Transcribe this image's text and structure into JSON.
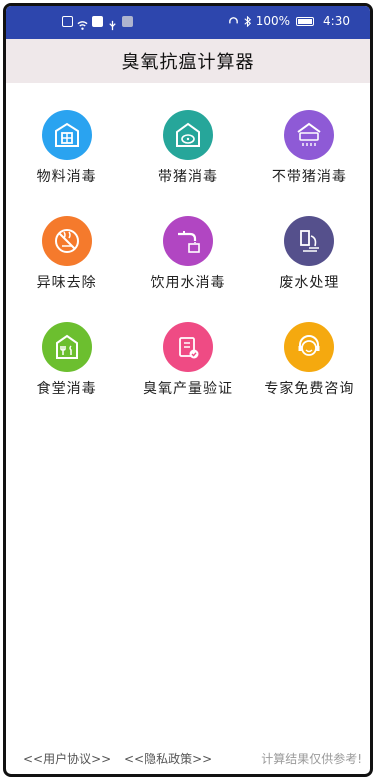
{
  "status_bar": {
    "battery": "100%",
    "time": "4:30"
  },
  "app": {
    "title": "臭氧抗瘟计算器"
  },
  "tiles": [
    {
      "label": "物料消毒",
      "icon": "warehouse-icon",
      "color": "#2aa3f0"
    },
    {
      "label": "带猪消毒",
      "icon": "barn-pig-icon",
      "color": "#26a69a"
    },
    {
      "label": "不带猪消毒",
      "icon": "air-purifier-icon",
      "color": "#8e5ad6"
    },
    {
      "label": "异味去除",
      "icon": "no-smell-icon",
      "color": "#f57a2c"
    },
    {
      "label": "饮用水消毒",
      "icon": "water-faucet-icon",
      "color": "#b146c2"
    },
    {
      "label": "废水处理",
      "icon": "wastewater-icon",
      "color": "#55508c"
    },
    {
      "label": "食堂消毒",
      "icon": "canteen-icon",
      "color": "#6cbf2f"
    },
    {
      "label": "臭氧产量验证",
      "icon": "clipboard-check-icon",
      "color": "#ef4b84"
    },
    {
      "label": "专家免费咨询",
      "icon": "support-headset-icon",
      "color": "#f5a90f"
    }
  ],
  "footer": {
    "user_agreement": "<<用户协议>>",
    "privacy_policy": "<<隐私政策>>",
    "disclaimer": "计算结果仅供参考!"
  }
}
